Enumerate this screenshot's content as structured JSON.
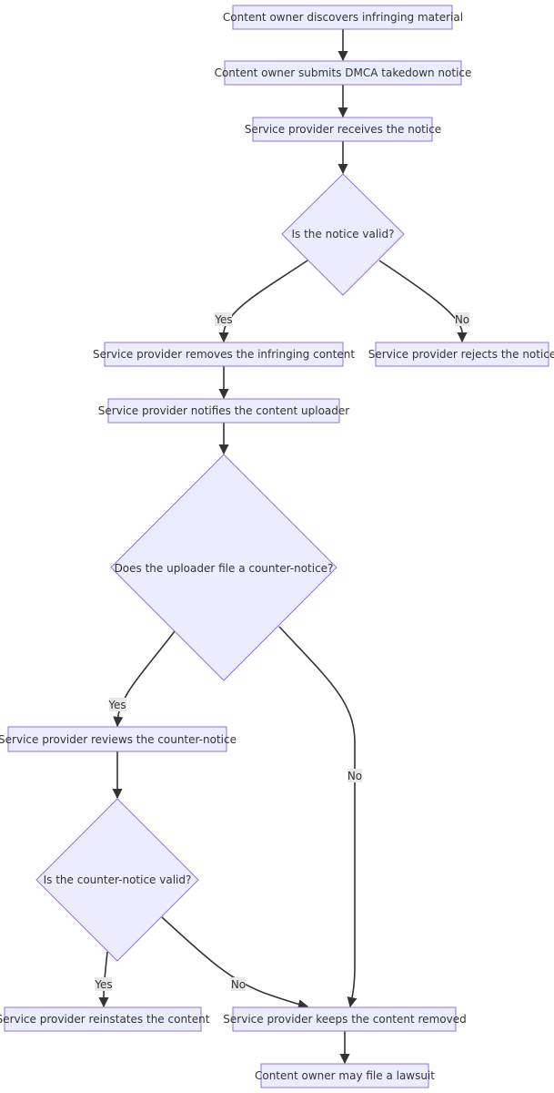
{
  "diagram": {
    "type": "flowchart",
    "nodes": [
      {
        "id": "n1",
        "shape": "rect",
        "label": "Content owner discovers infringing material"
      },
      {
        "id": "n2",
        "shape": "rect",
        "label": "Content owner submits DMCA takedown notice"
      },
      {
        "id": "n3",
        "shape": "rect",
        "label": "Service provider receives the notice"
      },
      {
        "id": "d1",
        "shape": "diamond",
        "label": "Is the notice valid?"
      },
      {
        "id": "n4",
        "shape": "rect",
        "label": "Service provider removes the infringing content"
      },
      {
        "id": "n7",
        "shape": "rect",
        "label": "Service provider rejects the notice"
      },
      {
        "id": "n5",
        "shape": "rect",
        "label": "Service provider notifies the content uploader"
      },
      {
        "id": "d2",
        "shape": "diamond",
        "label": "Does the uploader file a counter-notice?"
      },
      {
        "id": "n6",
        "shape": "rect",
        "label": "Service provider reviews the counter-notice"
      },
      {
        "id": "d3",
        "shape": "diamond",
        "label": "Is the counter-notice valid?"
      },
      {
        "id": "n8",
        "shape": "rect",
        "label": "Service provider reinstates the content"
      },
      {
        "id": "n9",
        "shape": "rect",
        "label": "Service provider keeps the content removed"
      },
      {
        "id": "n10",
        "shape": "rect",
        "label": "Content owner may file a lawsuit"
      }
    ],
    "edges": [
      {
        "from": "n1",
        "to": "n2",
        "label": ""
      },
      {
        "from": "n2",
        "to": "n3",
        "label": ""
      },
      {
        "from": "n3",
        "to": "d1",
        "label": ""
      },
      {
        "from": "d1",
        "to": "n4",
        "label": "Yes"
      },
      {
        "from": "d1",
        "to": "n7",
        "label": "No"
      },
      {
        "from": "n4",
        "to": "n5",
        "label": ""
      },
      {
        "from": "n5",
        "to": "d2",
        "label": ""
      },
      {
        "from": "d2",
        "to": "n6",
        "label": "Yes"
      },
      {
        "from": "d2",
        "to": "n9",
        "label": "No"
      },
      {
        "from": "n6",
        "to": "d3",
        "label": ""
      },
      {
        "from": "d3",
        "to": "n8",
        "label": "Yes"
      },
      {
        "from": "d3",
        "to": "n9",
        "label": "No"
      },
      {
        "from": "n9",
        "to": "n10",
        "label": ""
      }
    ],
    "colors": {
      "node_fill": "#ECECFF",
      "node_stroke": "#9370DB",
      "text": "#333333",
      "edge": "#333333",
      "edge_label_bg": "#E8E8E8"
    }
  }
}
